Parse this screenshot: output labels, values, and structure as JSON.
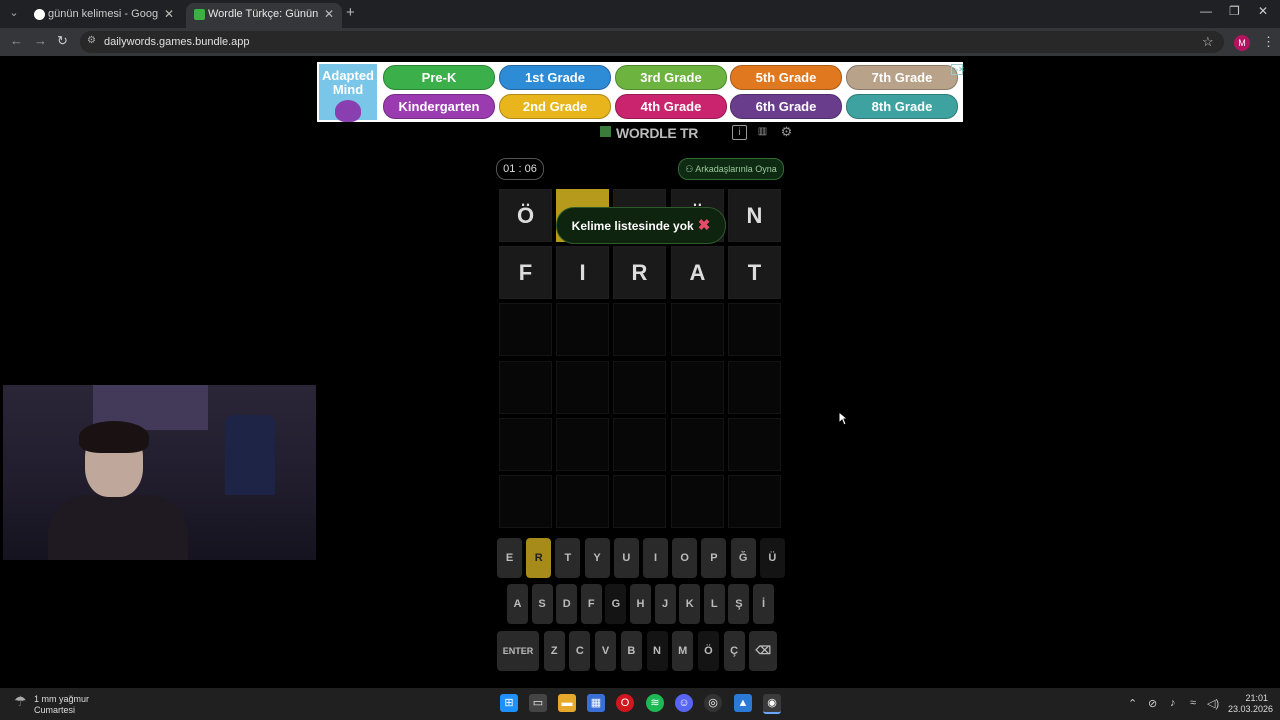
{
  "browser": {
    "tabs": [
      {
        "title": "günün kelimesi - Google Search",
        "favicon_color": "#ffffff"
      },
      {
        "title": "Wordle Türkçe: Günün Kelimesi",
        "favicon_color": "#3cb043"
      }
    ],
    "url": "dailywords.games.bundle.app",
    "profile_initial": "M"
  },
  "ad": {
    "logo": "Adapted Mind",
    "grades": [
      {
        "label": "Pre-K",
        "color": "#3bb04a"
      },
      {
        "label": "1st Grade",
        "color": "#2e8bd6"
      },
      {
        "label": "3rd Grade",
        "color": "#6db33f"
      },
      {
        "label": "5th Grade",
        "color": "#e0781f"
      },
      {
        "label": "7th Grade",
        "color": "#b8a38a"
      },
      {
        "label": "Kindergarten",
        "color": "#9b3bb0"
      },
      {
        "label": "2nd Grade",
        "color": "#e8b51c"
      },
      {
        "label": "4th Grade",
        "color": "#c9246d"
      },
      {
        "label": "6th Grade",
        "color": "#6a3d8c"
      },
      {
        "label": "8th Grade",
        "color": "#3ea3a0"
      }
    ]
  },
  "game": {
    "title": "WORDLE TR",
    "timer": "01 : 06",
    "friends_button": "Arkadaşlarınla Oyna",
    "toast": "Kelime listesinde yok",
    "rows": [
      [
        {
          "l": "Ö",
          "s": "filled"
        },
        {
          "l": "",
          "s": "yellow"
        },
        {
          "l": "",
          "s": "filled"
        },
        {
          "l": "Ü",
          "s": "filled"
        },
        {
          "l": "N",
          "s": "filled"
        }
      ],
      [
        {
          "l": "F",
          "s": "filled"
        },
        {
          "l": "I",
          "s": "filled"
        },
        {
          "l": "R",
          "s": "filled"
        },
        {
          "l": "A",
          "s": "filled"
        },
        {
          "l": "T",
          "s": "filled"
        }
      ],
      [
        {
          "l": "",
          "s": "empty"
        },
        {
          "l": "",
          "s": "empty"
        },
        {
          "l": "",
          "s": "empty"
        },
        {
          "l": "",
          "s": "empty"
        },
        {
          "l": "",
          "s": "empty"
        }
      ],
      [
        {
          "l": "",
          "s": "empty"
        },
        {
          "l": "",
          "s": "empty"
        },
        {
          "l": "",
          "s": "empty"
        },
        {
          "l": "",
          "s": "empty"
        },
        {
          "l": "",
          "s": "empty"
        }
      ],
      [
        {
          "l": "",
          "s": "empty"
        },
        {
          "l": "",
          "s": "empty"
        },
        {
          "l": "",
          "s": "empty"
        },
        {
          "l": "",
          "s": "empty"
        },
        {
          "l": "",
          "s": "empty"
        }
      ],
      [
        {
          "l": "",
          "s": "empty"
        },
        {
          "l": "",
          "s": "empty"
        },
        {
          "l": "",
          "s": "empty"
        },
        {
          "l": "",
          "s": "empty"
        },
        {
          "l": "",
          "s": "empty"
        }
      ]
    ],
    "keyboard": [
      [
        {
          "k": "E",
          "s": "normal"
        },
        {
          "k": "R",
          "s": "yellow"
        },
        {
          "k": "T",
          "s": "normal"
        },
        {
          "k": "Y",
          "s": "normal"
        },
        {
          "k": "U",
          "s": "normal"
        },
        {
          "k": "I",
          "s": "normal"
        },
        {
          "k": "O",
          "s": "normal"
        },
        {
          "k": "P",
          "s": "normal"
        },
        {
          "k": "Ğ",
          "s": "normal"
        },
        {
          "k": "Ü",
          "s": "dark"
        }
      ],
      [
        {
          "k": "A",
          "s": "normal"
        },
        {
          "k": "S",
          "s": "normal"
        },
        {
          "k": "D",
          "s": "normal"
        },
        {
          "k": "F",
          "s": "normal"
        },
        {
          "k": "G",
          "s": "dark"
        },
        {
          "k": "H",
          "s": "normal"
        },
        {
          "k": "J",
          "s": "normal"
        },
        {
          "k": "K",
          "s": "normal"
        },
        {
          "k": "L",
          "s": "normal"
        },
        {
          "k": "Ş",
          "s": "normal"
        },
        {
          "k": "İ",
          "s": "normal"
        }
      ],
      [
        {
          "k": "ENTER",
          "s": "normal"
        },
        {
          "k": "Z",
          "s": "normal"
        },
        {
          "k": "C",
          "s": "normal"
        },
        {
          "k": "V",
          "s": "normal"
        },
        {
          "k": "B",
          "s": "normal"
        },
        {
          "k": "N",
          "s": "dark"
        },
        {
          "k": "M",
          "s": "normal"
        },
        {
          "k": "Ö",
          "s": "dark"
        },
        {
          "k": "Ç",
          "s": "normal"
        },
        {
          "k": "⌫",
          "s": "normal"
        }
      ]
    ]
  },
  "taskbar": {
    "weather_line1": "1 mm yağmur",
    "weather_line2": "Cumartesi",
    "time": "21:01",
    "date": "23.03.2026"
  }
}
